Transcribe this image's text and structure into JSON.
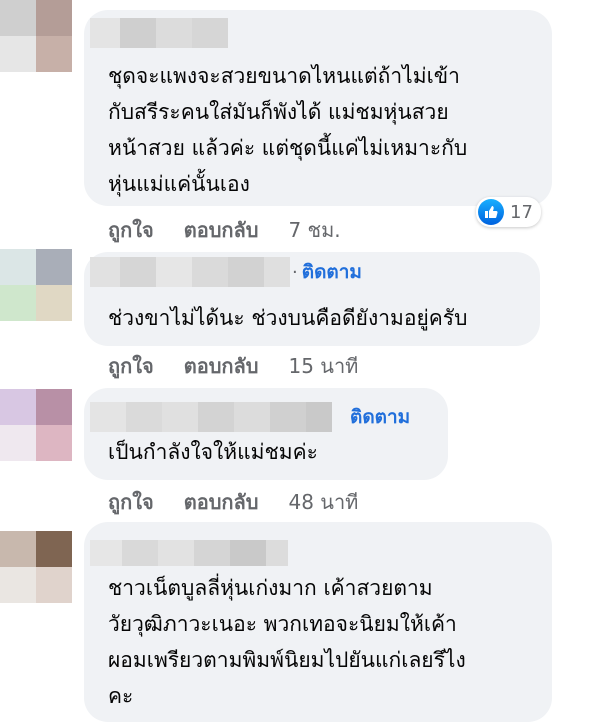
{
  "colors": {
    "bubble": "#f0f2f5",
    "link_blue": "#216fdb",
    "meta_gray": "#65676b",
    "like_blue": "#1877f2"
  },
  "comments": [
    {
      "lines": [
        "ชุดจะแพงจะสวยขนาดไหนแต่ถ้าไม่เข้า",
        "กับสรีระคนใส่มันก็พังได้ แม่ชมหุ่นสวย",
        "หน้าสวย แล้วค่ะ แต่ชุดนี้แค่ไม่เหมาะกับ",
        "หุ่นแม่แค่นั้นเอง"
      ],
      "like_label": "ถูกใจ",
      "reply_label": "ตอบกลับ",
      "time": "7 ชม.",
      "reaction": {
        "icon": "thumbs-up-icon",
        "count": "17"
      }
    },
    {
      "follow_label": "ติดตาม",
      "lines": [
        "ช่วงขาไม่ได้นะ ช่วงบนคือดียังามอยู่ครับ"
      ],
      "like_label": "ถูกใจ",
      "reply_label": "ตอบกลับ",
      "time": "15 นาที"
    },
    {
      "follow_label": "ติดตาม",
      "lines": [
        "เป็นกำลังใจให้แม่ชมค่ะ"
      ],
      "like_label": "ถูกใจ",
      "reply_label": "ตอบกลับ",
      "time": "48 นาที"
    },
    {
      "lines": [
        "ชาวเน็ตบูลลี่หุ่นเก่งมาก เค้าสวยตาม",
        "วัยวุฒิภาวะเนอะ พวกเทอจะนิยมให้เค้า",
        "ผอมเพรียวตามพิมพ์นิยมไปยันแก่เลยรึไง",
        "คะ"
      ]
    }
  ]
}
